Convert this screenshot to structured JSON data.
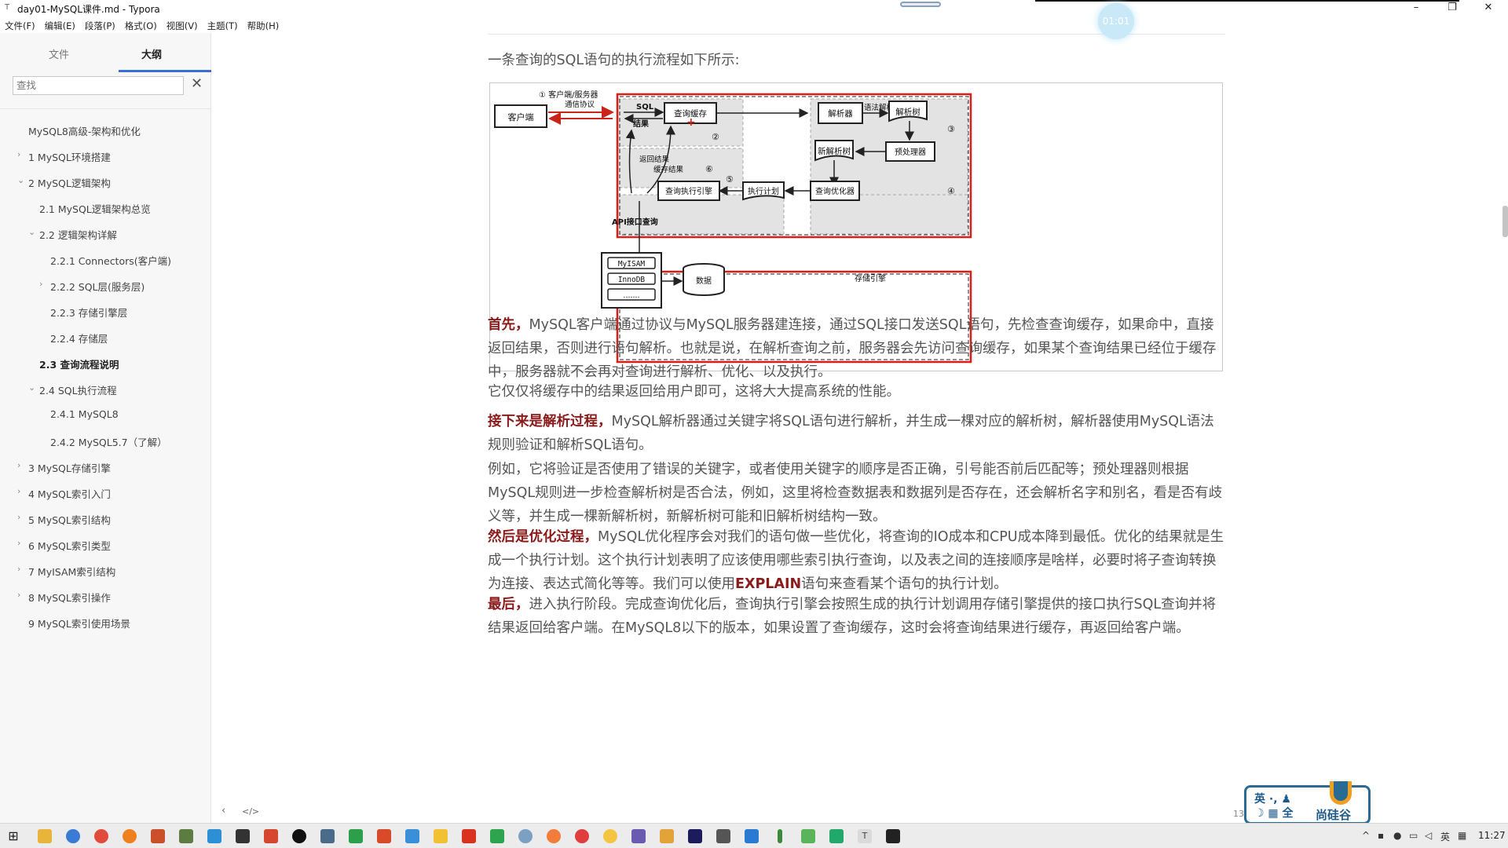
{
  "window": {
    "title": "day01-MySQL课件.md - Typora",
    "app_icon": "T"
  },
  "menu": [
    "文件(F)",
    "编辑(E)",
    "段落(P)",
    "格式(O)",
    "视图(V)",
    "主题(T)",
    "帮助(H)"
  ],
  "sidebar": {
    "tabs": [
      "文件",
      "大纲"
    ],
    "active_tab": "大纲",
    "search_placeholder": "查找",
    "outline": [
      {
        "label": "MySQL8高级-架构和优化",
        "level": 0,
        "chev": ""
      },
      {
        "label": "1 MySQL环境搭建",
        "level": 0,
        "chev": "›"
      },
      {
        "label": "2 MySQL逻辑架构",
        "level": 0,
        "chev": "⌄"
      },
      {
        "label": "2.1 MySQL逻辑架构总览",
        "level": 1,
        "chev": ""
      },
      {
        "label": "2.2 逻辑架构详解",
        "level": 1,
        "chev": "⌄"
      },
      {
        "label": "2.2.1 Connectors(客户端)",
        "level": 2,
        "chev": ""
      },
      {
        "label": "2.2.2 SQL层(服务层)",
        "level": 2,
        "chev": "›"
      },
      {
        "label": "2.2.3 存储引擎层",
        "level": 2,
        "chev": ""
      },
      {
        "label": "2.2.4 存储层",
        "level": 2,
        "chev": ""
      },
      {
        "label": "2.3 查询流程说明",
        "level": 1,
        "chev": "",
        "active": true
      },
      {
        "label": "2.4 SQL执行流程",
        "level": 1,
        "chev": "⌄"
      },
      {
        "label": "2.4.1 MySQL8",
        "level": 2,
        "chev": ""
      },
      {
        "label": "2.4.2 MySQL5.7（了解）",
        "level": 2,
        "chev": ""
      },
      {
        "label": "3 MySQL存储引擎",
        "level": 0,
        "chev": "›"
      },
      {
        "label": "4 MySQL索引入门",
        "level": 0,
        "chev": "›"
      },
      {
        "label": "5 MySQL索引结构",
        "level": 0,
        "chev": "›"
      },
      {
        "label": "6 MySQL索引类型",
        "level": 0,
        "chev": "›"
      },
      {
        "label": "7 MyISAM索引结构",
        "level": 0,
        "chev": "›"
      },
      {
        "label": "8 MySQL索引操作",
        "level": 0,
        "chev": "›"
      },
      {
        "label": "9 MySQL索引使用场景",
        "level": 0,
        "chev": ""
      }
    ],
    "bottom_left": "‹",
    "bottom_code": "</>"
  },
  "content": {
    "intro": "一条查询的SQL语句的执行流程如下所示:",
    "p1_em": "首先，",
    "p1": "MySQL客户端通过协议与MySQL服务器建连接，通过SQL接口发送SQL语句，先检查查询缓存，如果命中，直接返回结果，否则进行语句解析。也就是说，在解析查询之前，服务器会先访问查询缓存，如果某个查询结果已经位于缓存中，服务器就不会再对查询进行解析、优化、以及执行。",
    "p2": "它仅仅将缓存中的结果返回给用户即可，这将大大提高系统的性能。",
    "p3_em": "接下来是解析过程，",
    "p3": "MySQL解析器通过关键字将SQL语句进行解析，并生成一棵对应的解析树，解析器使用MySQL语法规则验证和解析SQL语句。",
    "p4": "例如，它将验证是否使用了错误的关键字，或者使用关键字的顺序是否正确，引号能否前后匹配等；预处理器则根据MySQL规则进一步检查解析树是否合法，例如，这里将检查数据表和数据列是否存在，还会解析名字和别名，看是否有歧义等，并生成一棵新解析树，新解析树可能和旧解析树结构一致。",
    "p5_em": "然后是优化过程，",
    "p5a": "MySQL优化程序会对我们的语句做一些优化，将查询的IO成本和CPU成本降到最低。优化的结果就是生成一个执行计划。这个执行计划表明了应该使用哪些索引执行查询，以及表之间的连接顺序是啥样，必要时将子查询转换为连接、表达式简化等等。我们可以使用",
    "p5_code": "EXPLAIN",
    "p5b": "语句来查看某个语句的执行计划。",
    "p6_em": "最后，",
    "p6": "进入执行阶段。完成查询优化后，查询执行引擎会按照生成的执行计划调用存储引擎提供的接口执行SQL查询并将结果返回给客户端。在MySQL8以下的版本，如果设置了查询缓存，这时会将查询结果进行缓存，再返回给客户端。"
  },
  "diagram": {
    "client": "客户端",
    "proto1": "① 客户端/服务器",
    "proto2": "通信协议",
    "sql": "SQL",
    "result": "结果",
    "query_cache": "查询缓存",
    "n2": "②",
    "return_result": "返回结果",
    "cache_result": "缓存结果",
    "n6": "⑥",
    "parser": "解析器",
    "syntax_parse": "语法解析",
    "parse_tree": "解析树",
    "n3": "③",
    "new_parse_tree": "新解析树",
    "preprocessor": "预处理器",
    "exec_engine": "查询执行引擎",
    "n5": "⑤",
    "exec_plan": "执行计划",
    "optimizer": "查询优化器",
    "n4": "④",
    "api": "API接口查询",
    "myisam": "MyISAM",
    "innodb": "InnoDB",
    "dots": ".......",
    "data": "数据",
    "storage_engine": "存储引擎"
  },
  "status": {
    "timer": "01:01",
    "word_count": "13729 词"
  },
  "ime": {
    "line1": "英 ·, ♟",
    "line2": "☽ ▦ 全",
    "brand": "尚硅谷"
  },
  "taskbar": {
    "clock": "11:27",
    "tray_lang": "英"
  },
  "colors": {
    "accent": "#3b6fd4",
    "emphasis": "#8b1a1a",
    "diagram_red": "#d91e18"
  }
}
